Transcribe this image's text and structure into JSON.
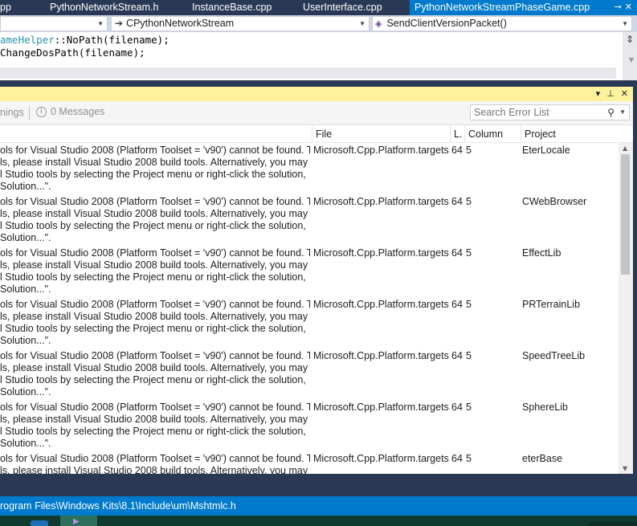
{
  "tabs": [
    {
      "label": "pp",
      "active": false
    },
    {
      "label": "PythonNetworkStream.h",
      "active": false
    },
    {
      "label": "InstanceBase.cpp",
      "active": false
    },
    {
      "label": "UserInterface.cpp",
      "active": false
    },
    {
      "label": "PythonNetworkStreamPhaseGame.cpp",
      "active": true
    }
  ],
  "tab_actions": {
    "pin": "⊸",
    "close": "✕"
  },
  "nav": {
    "class_selector": "CPythonNetworkStream",
    "member_selector": "SendClientVersionPacket()"
  },
  "code": {
    "line1_class": "ameHelper",
    "line1_rest": "::NoPath(filename);",
    "line2": "ChangeDosPath(filename);"
  },
  "error_list": {
    "warnings_label": "nings",
    "messages_label": "0 Messages",
    "search_placeholder": "Search Error List",
    "columns": {
      "file": "File",
      "line": "L.",
      "column": "Column",
      "project": "Project"
    },
    "rows": [
      {
        "desc": [
          "ols for Visual Studio 2008 (Platform Toolset = 'v90') cannot be found. To",
          "ls, please install Visual Studio 2008 build tools.  Alternatively, you may",
          "l Studio tools by selecting the Project menu or right-click the solution,",
          " Solution...\"."
        ],
        "file": "Microsoft.Cpp.Platform.targets",
        "line": "64",
        "column": "5",
        "project": "EterLocale"
      },
      {
        "desc": [
          "ols for Visual Studio 2008 (Platform Toolset = 'v90') cannot be found. To",
          "ls, please install Visual Studio 2008 build tools.  Alternatively, you may",
          "l Studio tools by selecting the Project menu or right-click the solution,",
          " Solution...\"."
        ],
        "file": "Microsoft.Cpp.Platform.targets",
        "line": "64",
        "column": "5",
        "project": "CWebBrowser"
      },
      {
        "desc": [
          "ols for Visual Studio 2008 (Platform Toolset = 'v90') cannot be found. To",
          "ls, please install Visual Studio 2008 build tools.  Alternatively, you may",
          "l Studio tools by selecting the Project menu or right-click the solution,",
          " Solution...\"."
        ],
        "file": "Microsoft.Cpp.Platform.targets",
        "line": "64",
        "column": "5",
        "project": "EffectLib"
      },
      {
        "desc": [
          "ols for Visual Studio 2008 (Platform Toolset = 'v90') cannot be found. To",
          "ls, please install Visual Studio 2008 build tools.  Alternatively, you may",
          "l Studio tools by selecting the Project menu or right-click the solution,",
          " Solution...\"."
        ],
        "file": "Microsoft.Cpp.Platform.targets",
        "line": "64",
        "column": "5",
        "project": "PRTerrainLib"
      },
      {
        "desc": [
          "ols for Visual Studio 2008 (Platform Toolset = 'v90') cannot be found. To",
          "ls, please install Visual Studio 2008 build tools.  Alternatively, you may",
          "l Studio tools by selecting the Project menu or right-click the solution,",
          " Solution...\"."
        ],
        "file": "Microsoft.Cpp.Platform.targets",
        "line": "64",
        "column": "5",
        "project": "SpeedTreeLib"
      },
      {
        "desc": [
          "ols for Visual Studio 2008 (Platform Toolset = 'v90') cannot be found. To",
          "ls, please install Visual Studio 2008 build tools.  Alternatively, you may",
          "l Studio tools by selecting the Project menu or right-click the solution,",
          " Solution...\"."
        ],
        "file": "Microsoft.Cpp.Platform.targets",
        "line": "64",
        "column": "5",
        "project": "SphereLib"
      },
      {
        "desc": [
          "ols for Visual Studio 2008 (Platform Toolset = 'v90') cannot be found. To",
          "ls, please install Visual Studio 2008 build tools.  Alternatively, you may"
        ],
        "file": "Microsoft.Cpp.Platform.targets",
        "line": "64",
        "column": "5",
        "project": "eterBase"
      }
    ]
  },
  "status_bar": {
    "path": "rogram Files\\Windows Kits\\8.1\\Include\\um\\Mshtmlc.h"
  },
  "colors": {
    "accent": "#007acc",
    "chrome": "#293955",
    "panel_title": "#fff29d"
  }
}
